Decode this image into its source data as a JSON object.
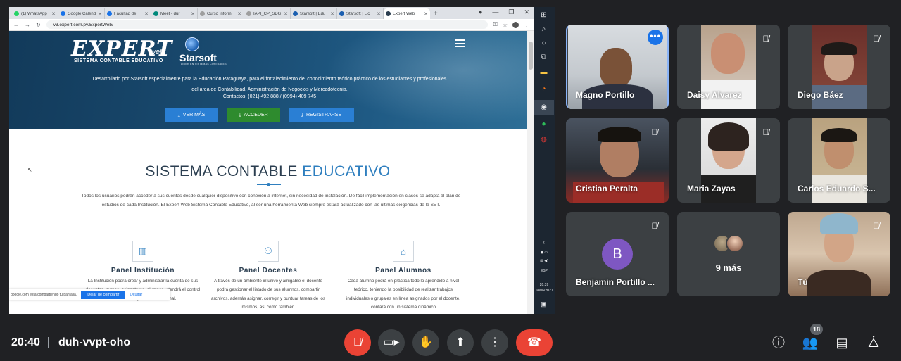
{
  "browser": {
    "tabs": [
      {
        "label": "(1) WhatsApp",
        "color": "#25d366"
      },
      {
        "label": "Google Calendar",
        "color": "#1a73e8"
      },
      {
        "label": "Facultad de",
        "color": "#1a73e8"
      },
      {
        "label": "Meet - dur",
        "color": "#00897b"
      },
      {
        "label": "Curso Inform",
        "color": "#9e9e9e"
      },
      {
        "label": "IAPI_CP_SDG",
        "color": "#9e9e9e"
      },
      {
        "label": "Starsoft | Edu",
        "color": "#1b5fb0"
      },
      {
        "label": "Starsoft | Lic",
        "color": "#1b5fb0"
      },
      {
        "label": "Expert Web",
        "color": "#2b3e50"
      }
    ],
    "url": "v3.expert.com.py/ExpertWeb/"
  },
  "site": {
    "logo_expert": "EXPERT",
    "logo_web": "web",
    "logo_sub": "SISTEMA CONTABLE EDUCATIVO",
    "starsoft_name": "Starsoft",
    "starsoft_sub": "LIDER EN SISTEMAS CONTABLES",
    "hero_line1": "Desarrollado por Starsoft especialmente para la Educación Paraguaya, para el fortalecimiento del conocimiento teórico práctico de los estudiantes y profesionales",
    "hero_line2": "del área de Contabilidad, Administración de Negocios y Mercadotecnia.",
    "contact": "Contactos: (021) 492 888 / (0994) 409 745",
    "btn_ver": "VER MÁS",
    "btn_acceder": "ACCEDER",
    "btn_registrarse": "REGISTRARSE",
    "section_title_a": "SISTEMA CONTABLE",
    "section_title_b": "EDUCATIVO",
    "section_para": "Todos los usuarios podrán acceder a sus cuentas desde cualquier dispositivo con conexión a internet, sin necesidad de instalación. De fácil implementación en clases se adapta al plan de estudios de cada Institución. El Expert Web Sistema Contable Educativo, al ser una herramienta Web siempre estará actualizado con las últimas exigencias de la SET.",
    "panels": [
      {
        "title": "Panel Institución",
        "text": "La Institución podrá crear y administrar la cuenta de sus docentes, cursos, asignaturas, alumnos y tendrá el control sobre toda la gestión institucional."
      },
      {
        "title": "Panel Docentes",
        "text": "A través de un ambiente intuitivo y amigable el docente podrá gestionar el listado de sus alumnos, compartir archivos, además asignar, corregir y puntuar tareas de los mismos, así como también"
      },
      {
        "title": "Panel Alumnos",
        "text": "Cada alumno podrá en práctica todo lo aprendido a nivel teórico, teniendo la posibilidad de realizar trabajos individuales o grupales en línea asignados por el docente, contará con un sistema dinámico"
      }
    ],
    "share_text": "google.com está compartiendo tu pantalla.",
    "share_stop": "Dejar de compartir",
    "share_hide": "Ocultar"
  },
  "taskbar": {
    "time": "20:39",
    "date": "18/06/2021",
    "lang": "ESP"
  },
  "participants": [
    {
      "name": "Magno Portillo",
      "muted": false
    },
    {
      "name": "Daisy Alvarez",
      "muted": true
    },
    {
      "name": "Diego Báez",
      "muted": true
    },
    {
      "name": "Cristian Peralta",
      "muted": true
    },
    {
      "name": "Maria Zayas",
      "muted": true
    },
    {
      "name": "Carlos Eduardo S...",
      "muted": false
    },
    {
      "name": "Benjamin Portillo ...",
      "initial": "B",
      "muted": true
    },
    {
      "name": "9 más"
    },
    {
      "name": "Tú",
      "muted": true
    }
  ],
  "bottombar": {
    "clock": "20:40",
    "meeting_code": "duh-vvpt-oho",
    "participant_count": "18"
  }
}
